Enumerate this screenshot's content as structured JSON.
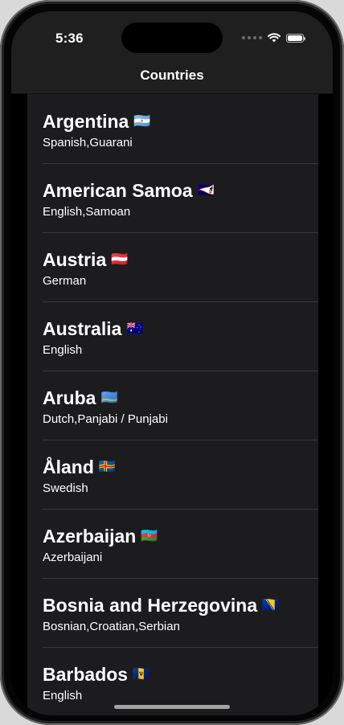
{
  "status_bar": {
    "time": "5:36",
    "signal_icon": "signal-dots-icon",
    "wifi_icon": "wifi-icon",
    "battery_icon": "battery-icon",
    "battery_level": 1.0
  },
  "nav": {
    "title": "Countries"
  },
  "countries": [
    {
      "name": "Argentina",
      "flag": "🇦🇷",
      "languages": "Spanish,Guarani"
    },
    {
      "name": "American Samoa",
      "flag": "🇦🇸",
      "languages": "English,Samoan"
    },
    {
      "name": "Austria",
      "flag": "🇦🇹",
      "languages": "German"
    },
    {
      "name": "Australia",
      "flag": "🇦🇺",
      "languages": "English"
    },
    {
      "name": "Aruba",
      "flag": "🇦🇼",
      "languages": "Dutch,Panjabi / Punjabi"
    },
    {
      "name": "Åland",
      "flag": "🇦🇽",
      "languages": "Swedish"
    },
    {
      "name": "Azerbaijan",
      "flag": "🇦🇿",
      "languages": "Azerbaijani"
    },
    {
      "name": "Bosnia and Herzegovina",
      "flag": "🇧🇦",
      "languages": "Bosnian,Croatian,Serbian"
    },
    {
      "name": "Barbados",
      "flag": "🇧🇧",
      "languages": "English"
    }
  ],
  "colors": {
    "list_background": "#1c1c1e",
    "nav_background": "#1f1f1f",
    "separator": "#38383a"
  }
}
